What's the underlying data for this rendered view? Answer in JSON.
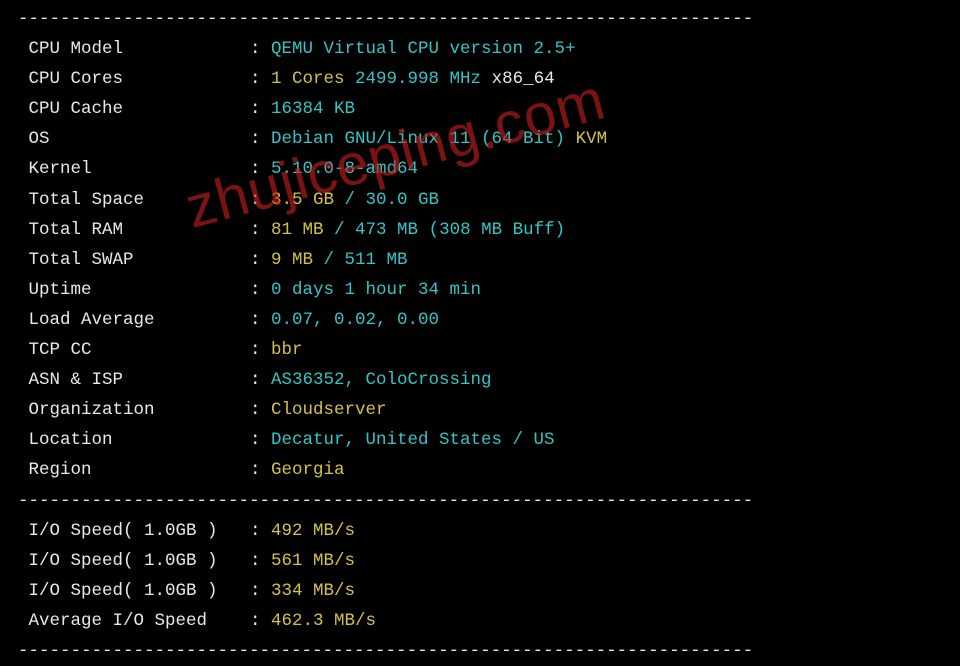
{
  "divider": "----------------------------------------------------------------------",
  "rows": [
    {
      "label": "CPU Model",
      "parts": [
        {
          "text": "QEMU Virtual CPU version 2.5+",
          "cls": "cyan"
        }
      ]
    },
    {
      "label": "CPU Cores",
      "parts": [
        {
          "text": "1 Cores",
          "cls": "yellow"
        },
        {
          "text": " 2499.998 MHz ",
          "cls": "cyan"
        },
        {
          "text": "x86_64",
          "cls": "white"
        }
      ]
    },
    {
      "label": "CPU Cache",
      "parts": [
        {
          "text": "16384 KB",
          "cls": "cyan"
        }
      ]
    },
    {
      "label": "OS",
      "parts": [
        {
          "text": "Debian GNU/Linux 11 (64 Bit)",
          "cls": "cyan"
        },
        {
          "text": " KVM",
          "cls": "yellow"
        }
      ]
    },
    {
      "label": "Kernel",
      "parts": [
        {
          "text": "5.10.0-8-amd64",
          "cls": "cyan"
        }
      ]
    },
    {
      "label": "Total Space",
      "parts": [
        {
          "text": "3.5 GB",
          "cls": "yellow"
        },
        {
          "text": " / ",
          "cls": "cyan"
        },
        {
          "text": "30.0 GB",
          "cls": "cyan"
        }
      ]
    },
    {
      "label": "Total RAM",
      "parts": [
        {
          "text": "81 MB",
          "cls": "yellow"
        },
        {
          "text": " / ",
          "cls": "cyan"
        },
        {
          "text": "473 MB",
          "cls": "cyan"
        },
        {
          "text": " (308 MB Buff)",
          "cls": "cyan"
        }
      ]
    },
    {
      "label": "Total SWAP",
      "parts": [
        {
          "text": "9 MB",
          "cls": "yellow"
        },
        {
          "text": " / ",
          "cls": "cyan"
        },
        {
          "text": "511 MB",
          "cls": "cyan"
        }
      ]
    },
    {
      "label": "Uptime",
      "parts": [
        {
          "text": "0 days 1 hour 34 min",
          "cls": "cyan"
        }
      ]
    },
    {
      "label": "Load Average",
      "parts": [
        {
          "text": "0.07, 0.02, 0.00",
          "cls": "cyan"
        }
      ]
    },
    {
      "label": "TCP CC",
      "parts": [
        {
          "text": "bbr",
          "cls": "yellow"
        }
      ]
    },
    {
      "label": "ASN & ISP",
      "parts": [
        {
          "text": "AS36352, ColoCrossing",
          "cls": "cyan"
        }
      ]
    },
    {
      "label": "Organization",
      "parts": [
        {
          "text": "Cloudserver",
          "cls": "yellow"
        }
      ]
    },
    {
      "label": "Location",
      "parts": [
        {
          "text": "Decatur, United States / US",
          "cls": "cyan"
        }
      ]
    },
    {
      "label": "Region",
      "parts": [
        {
          "text": "Georgia",
          "cls": "yellow"
        }
      ]
    }
  ],
  "io_rows": [
    {
      "label": "I/O Speed( 1.0GB )",
      "parts": [
        {
          "text": "492 MB/s",
          "cls": "yellow"
        }
      ]
    },
    {
      "label": "I/O Speed( 1.0GB )",
      "parts": [
        {
          "text": "561 MB/s",
          "cls": "yellow"
        }
      ]
    },
    {
      "label": "I/O Speed( 1.0GB )",
      "parts": [
        {
          "text": "334 MB/s",
          "cls": "yellow"
        }
      ]
    },
    {
      "label": "Average I/O Speed",
      "parts": [
        {
          "text": "462.3 MB/s",
          "cls": "yellow"
        }
      ]
    }
  ],
  "watermark": "zhujiceping.com"
}
